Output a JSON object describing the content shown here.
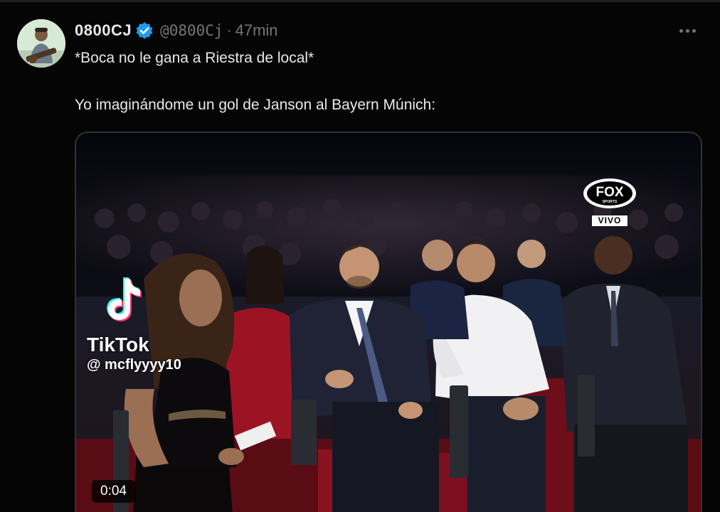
{
  "tweet": {
    "display_name": "0800CJ",
    "handle": "@0800Cj",
    "separator": "·",
    "time": "47min",
    "text_line1": "*Boca no le gana a Riestra de local*",
    "text_line2": "Yo imaginándome un gol de Janson al Bayern Múnich:"
  },
  "media": {
    "tiktok_label": "TikTok",
    "tiktok_handle": "@ mcflyyyy10",
    "broadcaster_logo": "FOX",
    "broadcaster_sub": "SPORTS",
    "live_badge": "VIVO",
    "duration": "0:04"
  },
  "icons": {
    "verified": "verified-badge-icon",
    "more": "more-options-icon",
    "tiktok": "tiktok-logo-icon"
  },
  "colors": {
    "background": "#000000",
    "text": "#e7e9ea",
    "muted": "#71767b",
    "verified": "#1d9bf0",
    "border": "#2f3336"
  }
}
